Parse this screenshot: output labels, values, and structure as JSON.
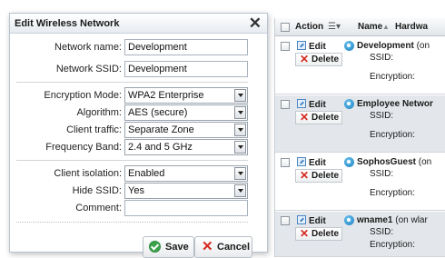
{
  "dialog": {
    "title": "Edit Wireless Network",
    "close_glyph": "✕",
    "fields": {
      "network_name": {
        "label": "Network name:",
        "value": "Development"
      },
      "network_ssid": {
        "label": "Network SSID:",
        "value": "Development"
      },
      "encryption_mode": {
        "label": "Encryption Mode:",
        "value": "WPA2 Enterprise"
      },
      "algorithm": {
        "label": "Algorithm:",
        "value": "AES (secure)"
      },
      "client_traffic": {
        "label": "Client traffic:",
        "value": "Separate Zone"
      },
      "frequency_band": {
        "label": "Frequency Band:",
        "value": "2.4 and 5 GHz"
      },
      "client_isolation": {
        "label": "Client isolation:",
        "value": "Enabled"
      },
      "hide_ssid": {
        "label": "Hide SSID:",
        "value": "Yes"
      },
      "comment": {
        "label": "Comment:",
        "value": ""
      }
    },
    "buttons": {
      "save": "Save",
      "cancel": "Cancel"
    }
  },
  "table": {
    "headers": {
      "action": "Action",
      "sort_glyph": "☰▾",
      "name": "Name",
      "sort_arrow": "▲",
      "hardware": "Hardwa"
    },
    "rows": [
      {
        "edit": "Edit",
        "delete": "Delete",
        "name": "Development",
        "suffix": " (on",
        "ssid_label": "SSID:",
        "enc_label": "Encryption:"
      },
      {
        "edit": "Edit",
        "delete": "Delete",
        "name": "Employee Networ",
        "suffix": "",
        "ssid_label": "SSID:",
        "enc_label": "Encryption:"
      },
      {
        "edit": "Edit",
        "delete": "Delete",
        "name": "SophosGuest",
        "suffix": " (on",
        "ssid_label": "SSID:",
        "enc_label": "Encryption:"
      },
      {
        "edit": "Edit",
        "delete": "Delete",
        "name": "wname1",
        "suffix": " (on wlar",
        "ssid_label": "SSID:",
        "enc_label": "Encryption:"
      }
    ]
  },
  "icons": {
    "close": "close-icon",
    "save": "check-circle-icon",
    "cancel": "x-icon",
    "edit": "edit-icon",
    "delete": "x-icon",
    "network": "wireless-network-icon"
  },
  "colors": {
    "accent_blue": "#1b7fc0",
    "delete_red": "#d6281e",
    "ok_green": "#3aa34a",
    "alt_row": "#e3e7eb"
  }
}
